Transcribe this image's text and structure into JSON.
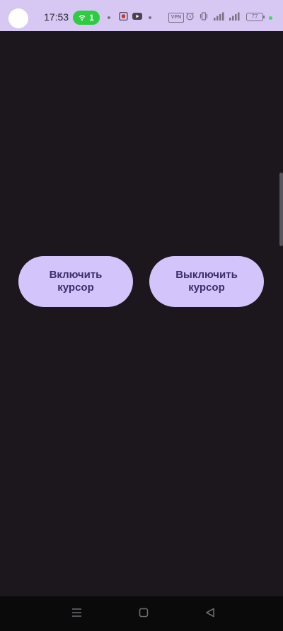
{
  "status_bar": {
    "time": "17:53",
    "hotspot_count": "1",
    "vpn_label": "VPN",
    "battery_level": "77",
    "icons": [
      "avatar",
      "hotspot-icon",
      "sim-icon",
      "youtube-icon",
      "vpn-badge",
      "alarm-icon",
      "vibrate-icon",
      "signal-icon",
      "wifi-signal-icon",
      "battery-icon"
    ],
    "colors": {
      "background": "#d6c7f3",
      "hotspot": "#2ecc40",
      "indicator": "#3ddc5a"
    }
  },
  "main": {
    "buttons": [
      {
        "label": "Включить\nкурсор"
      },
      {
        "label": "Выключить\nкурсор"
      }
    ],
    "colors": {
      "background": "#1b171c",
      "button": "#d3c4fb",
      "button_text": "#3d2e6b"
    }
  },
  "nav_bar": {
    "icons": [
      "menu-icon",
      "home-square-icon",
      "back-triangle-icon"
    ]
  }
}
